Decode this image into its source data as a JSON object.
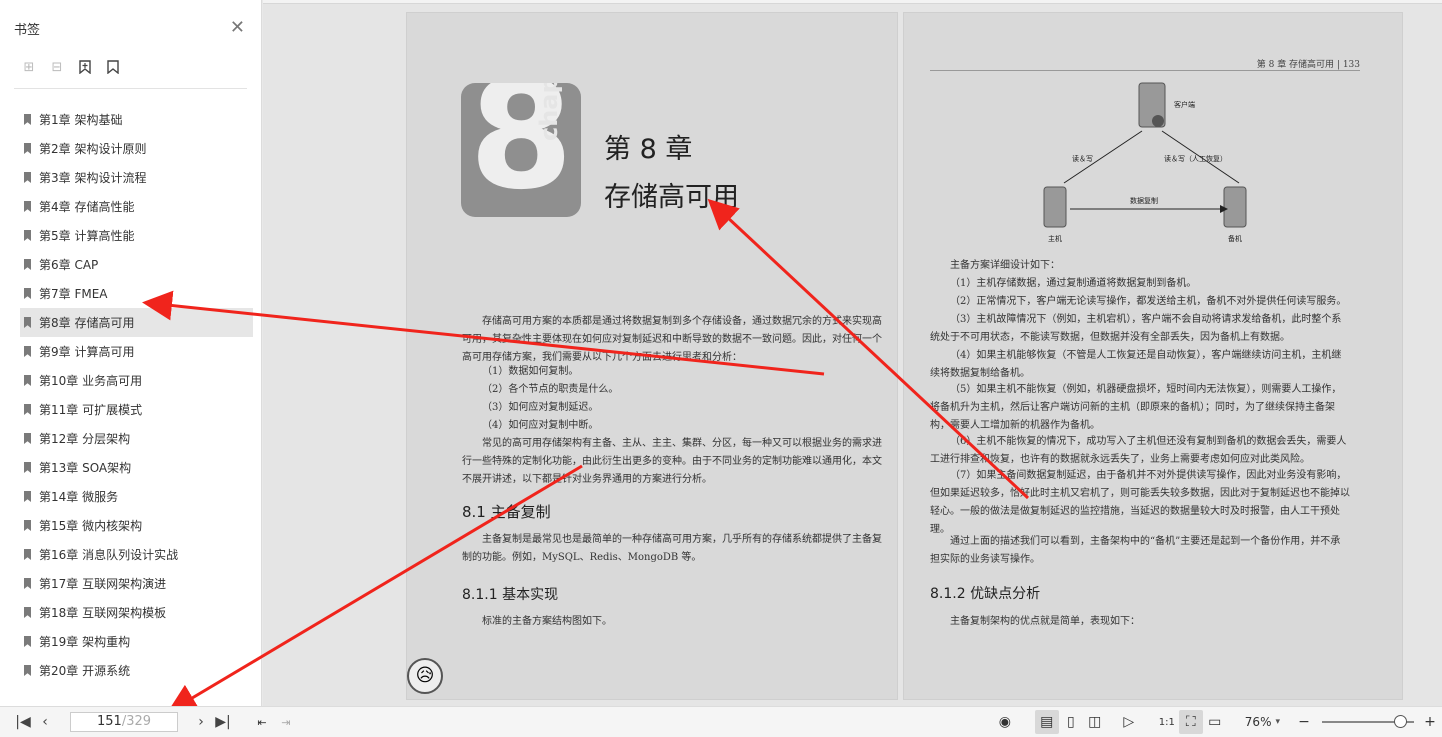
{
  "sidebar": {
    "title": "书签",
    "close_icon": "close-icon",
    "tools": [
      "add-bookmark-icon",
      "remove-bookmark-icon",
      "bookmark-add-icon",
      "bookmark-icon"
    ],
    "items": [
      {
        "label": "第1章 架构基础"
      },
      {
        "label": "第2章 架构设计原则"
      },
      {
        "label": "第3章 架构设计流程"
      },
      {
        "label": "第4章 存储高性能"
      },
      {
        "label": "第5章 计算高性能"
      },
      {
        "label": "第6章 CAP"
      },
      {
        "label": "第7章 FMEA"
      },
      {
        "label": "第8章 存储高可用",
        "active": true
      },
      {
        "label": "第9章 计算高可用"
      },
      {
        "label": "第10章 业务高可用"
      },
      {
        "label": "第11章 可扩展模式"
      },
      {
        "label": "第12章 分层架构"
      },
      {
        "label": "第13章 SOA架构"
      },
      {
        "label": "第14章 微服务"
      },
      {
        "label": "第15章 微内核架构"
      },
      {
        "label": "第16章 消息队列设计实战"
      },
      {
        "label": "第17章 互联网架构演进"
      },
      {
        "label": "第18章 互联网架构模板"
      },
      {
        "label": "第19章 架构重构"
      },
      {
        "label": "第20章 开源系统"
      }
    ]
  },
  "document": {
    "left_page": {
      "chapter_number": "8",
      "chapter_word": "chapter",
      "title_line1": "第 8 章",
      "title_line2": "存储高可用",
      "intro": "存储高可用方案的本质都是通过将数据复制到多个存储设备，通过数据冗余的方式来实现高可用，其复杂性主要体现在如何应对复制延迟和中断导致的数据不一致问题。因此，对任何一个高可用存储方案，我们需要从以下几个方面去进行思考和分析：",
      "points": [
        "（1）数据如何复制。",
        "（2）各个节点的职责是什么。",
        "（3）如何应对复制延迟。",
        "（4）如何应对复制中断。"
      ],
      "para2": "常见的高可用存储架构有主备、主从、主主、集群、分区，每一种又可以根据业务的需求进行一些特殊的定制化功能，由此衍生出更多的变种。由于不同业务的定制功能难以通用化，本文不展开讲述，以下都是针对业务界通用的方案进行分析。",
      "h_81": "8.1   主备复制",
      "para3": "主备复制是最常见也是最简单的一种存储高可用方案，几乎所有的存储系统都提供了主备复制的功能。例如，MySQL、Redis、MongoDB 等。",
      "h_811": "8.1.1   基本实现",
      "para4": "标准的主备方案结构图如下。"
    },
    "right_page": {
      "running_head": "第 8 章  存储高可用   |   133",
      "diagram": {
        "client": "客户端",
        "edge_left": "读＆写",
        "edge_right": "读＆写（人工恢复）",
        "replication": "数据复制",
        "primary": "主机",
        "backup": "备机"
      },
      "lead": "主备方案详细设计如下：",
      "items": [
        "（1）主机存储数据，通过复制通道将数据复制到备机。",
        "（2）正常情况下，客户端无论读写操作，都发送给主机，备机不对外提供任何读写服务。",
        "（3）主机故障情况下（例如，主机宕机），客户端不会自动将请求发给备机，此时整个系统处于不可用状态，不能读写数据，但数据并没有全部丢失，因为备机上有数据。",
        "（4）如果主机能够恢复（不管是人工恢复还是自动恢复），客户端继续访问主机，主机继续将数据复制给备机。",
        "（5）如果主机不能恢复（例如，机器硬盘损坏，短时间内无法恢复），则需要人工操作，将备机升为主机，然后让客户端访问新的主机（即原来的备机）；同时，为了继续保持主备架构，需要人工增加新的机器作为备机。",
        "（6）主机不能恢复的情况下，成功写入了主机但还没有复制到备机的数据会丢失，需要人工进行排查和恢复，也许有的数据就永远丢失了，业务上需要考虑如何应对此类风险。",
        "（7）如果主备间数据复制延迟，由于备机并不对外提供读写操作，因此对业务没有影响，但如果延迟较多，恰好此时主机又宕机了，则可能丢失较多数据，因此对于复制延迟也不能掉以轻心。一般的做法是做复制延迟的监控措施，当延迟的数据量较大时及时报警，由人工干预处理。"
      ],
      "summary": "通过上面的描述我们可以看到，主备架构中的“备机”主要还是起到一个备份作用，并不承担实际的业务读写操作。",
      "h_812": "8.1.2   优缺点分析",
      "last": "主备复制架构的优点就是简单，表现如下："
    }
  },
  "bottom_bar": {
    "current_page": "151",
    "total_pages": "/329",
    "zoom": "76%",
    "zoom_level": 0.85,
    "icons": [
      "first-page-icon",
      "prev-page-icon",
      "next-page-icon",
      "last-page-icon",
      "back-icon",
      "forward-icon",
      "eye-icon",
      "single-page-icon",
      "continuous-icon",
      "two-page-icon",
      "play-icon",
      "actual-size-icon",
      "fit-page-icon",
      "fit-width-icon",
      "zoom-out-icon",
      "zoom-in-icon"
    ]
  },
  "annotation_color": "#f0241c"
}
